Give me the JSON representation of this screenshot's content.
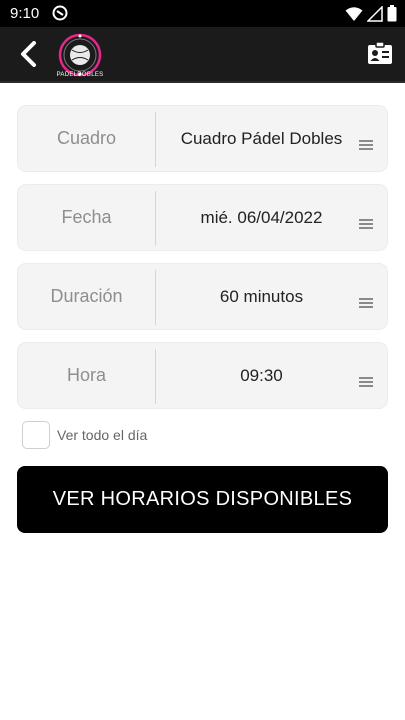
{
  "status": {
    "time": "9:10"
  },
  "header": {
    "logo_text": "PADELDOBLES"
  },
  "fields": [
    {
      "label": "Cuadro",
      "value": "Cuadro Pádel Dobles"
    },
    {
      "label": "Fecha",
      "value": "mié. 06/04/2022"
    },
    {
      "label": "Duración",
      "value": "60 minutos"
    },
    {
      "label": "Hora",
      "value": "09:30"
    }
  ],
  "options": {
    "show_all_day_label": "Ver todo el día",
    "show_all_day_checked": false
  },
  "actions": {
    "primary_label": "VER HORARIOS DISPONIBLES"
  },
  "colors": {
    "accent_pink": "#e6268a",
    "app_bar": "#1b1b1b",
    "button_bg": "#000000"
  }
}
